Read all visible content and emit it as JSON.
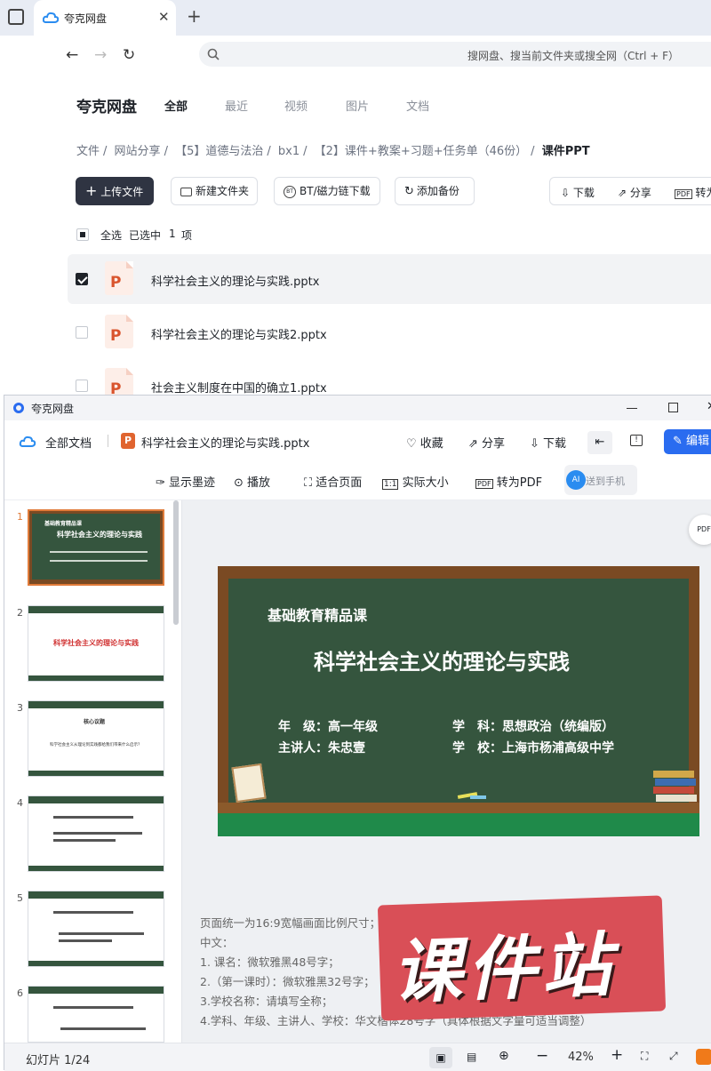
{
  "browser": {
    "tab_title": "夸克网盘",
    "search_placeholder": "搜网盘、搜当前文件夹或搜全网（Ctrl + F）"
  },
  "pan": {
    "brand": "夸克网盘",
    "nav": [
      "全部",
      "最近",
      "视频",
      "图片",
      "文档"
    ],
    "breadcrumb": [
      "文件",
      "网站分享",
      "【5】道德与法治",
      "bx1",
      "【2】课件+教案+习题+任务单（46份）",
      "课件PPT"
    ],
    "actions": {
      "upload": "上传文件",
      "new_folder": "新建文件夹",
      "bt": "BT/磁力链下载",
      "backup": "添加备份",
      "download": "下载",
      "share": "分享",
      "to_pdf": "转为"
    },
    "selection": {
      "select_all": "全选",
      "selected": "已选中",
      "count": "1",
      "unit": "项"
    },
    "files": [
      {
        "name": "科学社会主义的理论与实践.pptx",
        "checked": true
      },
      {
        "name": "科学社会主义的理论与实践2.pptx",
        "checked": false
      },
      {
        "name": "社会主义制度在中国的确立1.pptx",
        "checked": false
      }
    ]
  },
  "viewer": {
    "window_title": "夸克网盘",
    "all_docs": "全部文档",
    "file_name": "科学社会主义的理论与实践.pptx",
    "collect": "收藏",
    "share": "分享",
    "download": "下载",
    "edit": "编辑",
    "show_ink": "显示墨迹",
    "play": "播放",
    "fit_page": "适合页面",
    "actual_size": "实际大小",
    "to_pdf": "转为PDF",
    "to_phone": "送到手机",
    "thumb_numbers": [
      "1",
      "2",
      "3",
      "4",
      "5",
      "6"
    ],
    "thumb_texts": {
      "t1_course": "基础教育精品课",
      "t1_title": "科学社会主义的理论与实践",
      "t2_title": "科学社会主义的理论与实践",
      "t3_title": "核心议题",
      "t3_body": "科学社会主义从理论到实践都给我们带来什么启示？"
    },
    "slide": {
      "course": "基础教育精品课",
      "title": "科学社会主义的理论与实践",
      "grade_label": "年　级：高一年级",
      "subject_label": "学　科：思想政治（统编版）",
      "speaker_label": "主讲人：朱忠壹",
      "school_label": "学　校：上海市杨浦高级中学"
    },
    "notes": [
      "页面统一为16:9宽幅画面比例尺寸；PPT统一格式为PPT或PPTX。",
      "中文：",
      "1. 课名：微软雅黑48号字；",
      "2.（第一课时）：微软雅黑32号字；",
      "3.学校名称：请填写全称；",
      "4.学科、年级、主讲人、学校：华文楷体28号字（具体根据文字量可适当调整）"
    ],
    "status": {
      "slide_counter": "幻灯片 1/24",
      "zoom": "42%"
    },
    "watermark": "课件站"
  }
}
